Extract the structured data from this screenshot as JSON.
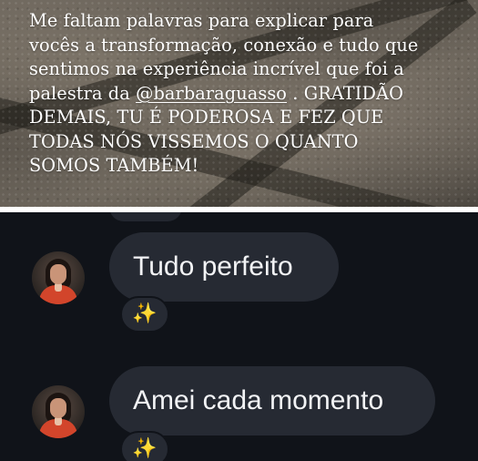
{
  "story": {
    "lines": [
      "Me faltam palavras para explicar para",
      "vocês a transformação, conexão e tudo que",
      "sentimos na experiência incrível que foi a",
      "palestra da ",
      " . GRATIDÃO",
      "DEMAIS, TU É PODEROSA E FEZ QUE",
      "TODAS NÓS VISSEMOS O QUANTO",
      "SOMOS TAMBÉM!"
    ],
    "mention": "@barbaraguasso",
    "text_color": "#ffffff"
  },
  "chat": {
    "background": "#101319",
    "bubble_color": "#262a33",
    "messages": [
      {
        "text": "Tudo perfeito",
        "reaction": "✨",
        "avatar_icon": "profile-photo"
      },
      {
        "text": "Amei cada momento",
        "reaction": "✨",
        "avatar_icon": "profile-photo"
      }
    ]
  }
}
